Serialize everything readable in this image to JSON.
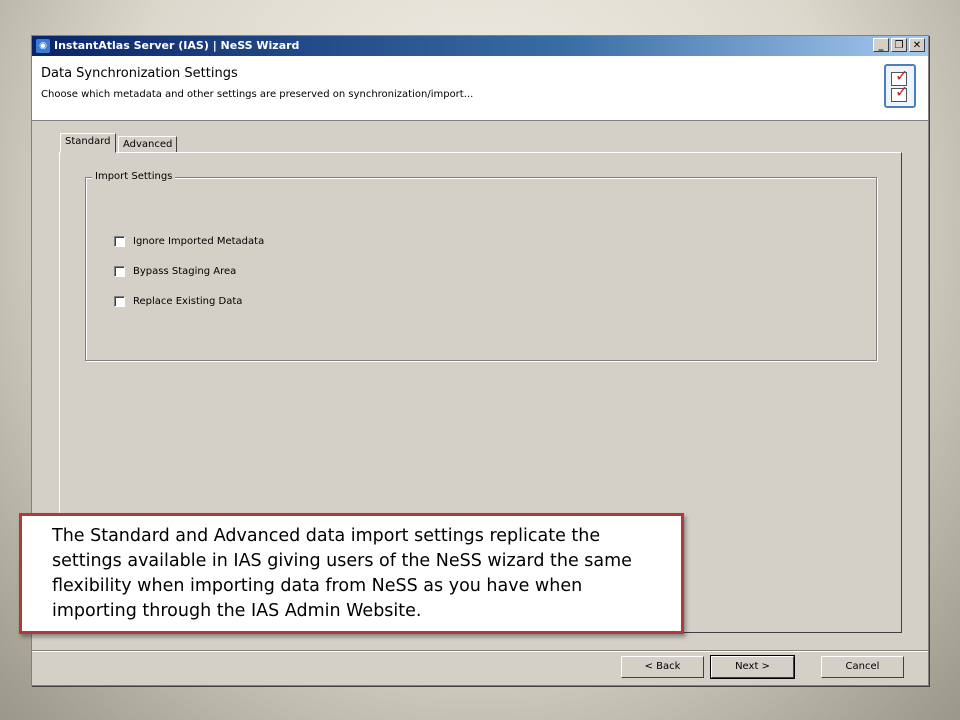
{
  "window": {
    "title": "InstantAtlas Server (IAS) | NeSS Wizard",
    "app_icon": "instantatlas-logo-icon",
    "controls": {
      "minimize": "_",
      "maximize": "❐",
      "close": "✕"
    }
  },
  "header": {
    "title": "Data Synchronization Settings",
    "subtitle": "Choose which metadata and other settings are preserved on synchronization/import...",
    "icon": "checklist-icon"
  },
  "tabs": [
    {
      "label": "Standard",
      "active": true
    },
    {
      "label": "Advanced",
      "active": false
    }
  ],
  "import_settings": {
    "legend": "Import Settings",
    "options": [
      {
        "label": "Ignore Imported Metadata",
        "checked": false
      },
      {
        "label": "Bypass Staging Area",
        "checked": false
      },
      {
        "label": "Replace Existing Data",
        "checked": false
      }
    ]
  },
  "buttons": {
    "back": "< Back",
    "next": "Next >",
    "cancel": "Cancel"
  },
  "callout": {
    "text": "The Standard and Advanced data import settings replicate the settings available in IAS giving users of the NeSS wizard the same flexibility when importing data from NeSS as you have when importing through the IAS Admin Website."
  },
  "colors": {
    "titlebar_start": "#0a246a",
    "dialog_face": "#d4d0c8",
    "callout_border": "#b03a3a"
  }
}
